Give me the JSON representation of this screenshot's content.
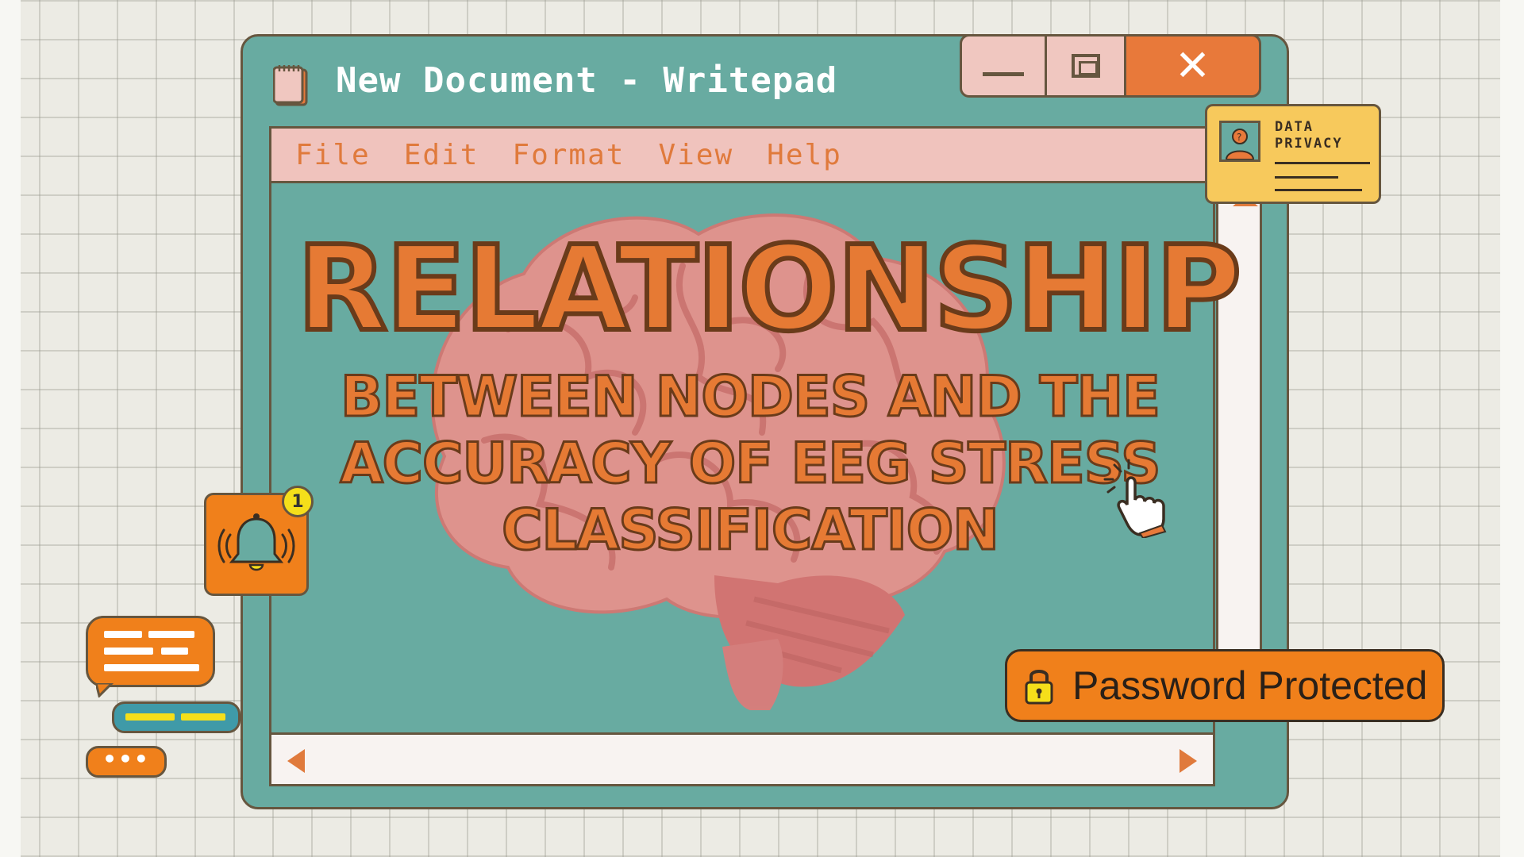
{
  "window": {
    "title": "New Document - Writepad",
    "controls": {
      "minimize": "minimize-icon",
      "maximize": "maximize-icon",
      "close": "close-icon"
    }
  },
  "menu": {
    "items": [
      "File",
      "Edit",
      "Format",
      "View",
      "Help"
    ]
  },
  "document": {
    "headline": "RELATIONSHIP",
    "subhead_lines": [
      "BETWEEN NODES AND THE",
      "ACCURACY OF EEG STRESS",
      "CLASSIFICATION"
    ]
  },
  "privacy_card": {
    "title_line1": "DATA",
    "title_line2": "PRIVACY"
  },
  "notification": {
    "count": "1"
  },
  "chat": {
    "ellipsis": "•••"
  },
  "password_badge": {
    "label": "Password Protected"
  },
  "colors": {
    "window_teal": "#68aba1",
    "menu_pink": "#f0c3bd",
    "accent_orange": "#e67a34",
    "outline_brown": "#66563f",
    "card_yellow": "#f7c95c"
  }
}
